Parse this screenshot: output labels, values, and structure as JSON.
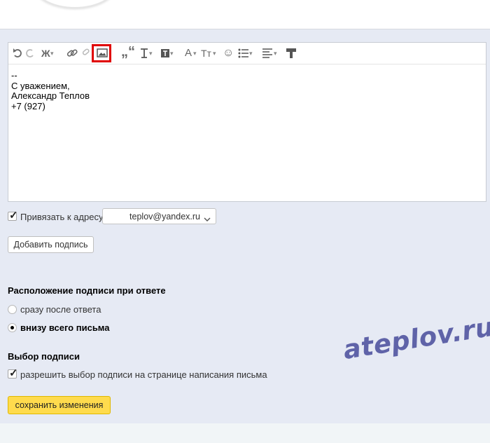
{
  "toolbar": {
    "icons": [
      "undo-icon",
      "redo-icon",
      "bold-icon",
      "link-icon",
      "unlink-icon",
      "insert-image-icon",
      "quote-icon",
      "text-style-icon",
      "text-background-icon",
      "font-color-icon",
      "font-size-icon",
      "emoji-icon",
      "list-icon",
      "align-icon",
      "clear-format-icon"
    ],
    "bold_glyph": "Ж",
    "font_color_glyph": "A",
    "font_size_glyph": "Tт",
    "highlight_color": "#e00000"
  },
  "signature": {
    "lines": [
      "--",
      "С уважением,",
      "Александр Теплов",
      "+7 (927)"
    ]
  },
  "bind_address": {
    "label": "Привязать к адресу",
    "checked": true,
    "email": "teplov@yandex.ru"
  },
  "add_signature_button": "Добавить подпись",
  "placement": {
    "heading": "Расположение подписи при ответе",
    "options": [
      {
        "label": "сразу после ответа",
        "selected": false
      },
      {
        "label": "внизу всего письма",
        "selected": true
      }
    ]
  },
  "choice": {
    "heading": "Выбор подписи",
    "allow_label": "разрешить выбор подписи на странице написания письма",
    "checked": true
  },
  "save_button": "сохранить изменения",
  "watermark": "ateplov.ru",
  "colors": {
    "panel_bg": "#e6eaf4",
    "save_button_bg": "#ffdb4d",
    "watermark": "#5f63a8"
  }
}
